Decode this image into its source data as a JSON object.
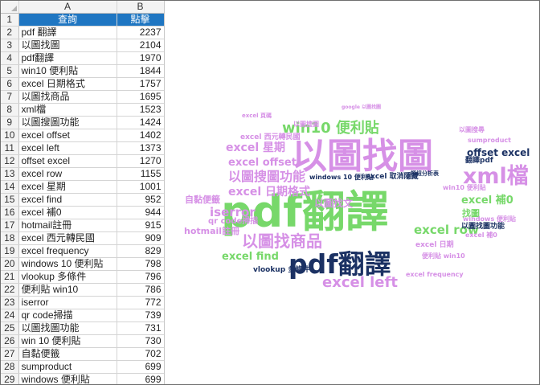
{
  "sheet": {
    "columns": [
      "A",
      "B"
    ],
    "headers": {
      "term": "查詢",
      "clicks": "點擊"
    },
    "header_fill": "#1f76c2",
    "rows": [
      [
        "pdf 翻譯",
        "2237"
      ],
      [
        "以圖找圖",
        "2104"
      ],
      [
        "pdf翻譯",
        "1970"
      ],
      [
        "win10 便利貼",
        "1844"
      ],
      [
        "excel 日期格式",
        "1757"
      ],
      [
        "以圖找商品",
        "1695"
      ],
      [
        "xml檔",
        "1523"
      ],
      [
        "以圖搜圖功能",
        "1424"
      ],
      [
        "excel offset",
        "1402"
      ],
      [
        "excel left",
        "1373"
      ],
      [
        "offset excel",
        "1270"
      ],
      [
        "excel row",
        "1155"
      ],
      [
        "excel 星期",
        "1001"
      ],
      [
        "excel find",
        "952"
      ],
      [
        "excel 補0",
        "944"
      ],
      [
        "hotmail註冊",
        "915"
      ],
      [
        "excel 西元轉民國",
        "909"
      ],
      [
        "excel frequency",
        "829"
      ],
      [
        "windows 10 便利貼",
        "798"
      ],
      [
        "vlookup 多條件",
        "796"
      ],
      [
        "便利貼 win10",
        "786"
      ],
      [
        "iserror",
        "772"
      ],
      [
        "qr code掃描",
        "739"
      ],
      [
        "以圖找圖功能",
        "731"
      ],
      [
        "win 10 便利貼",
        "730"
      ],
      [
        "自黏便籤",
        "702"
      ],
      [
        "sumproduct",
        "699"
      ],
      [
        "windows 便利貼",
        "699"
      ]
    ]
  },
  "cloud": {
    "colors": {
      "green": "#77d86a",
      "violet": "#d690e6",
      "navy": "#1b3163"
    },
    "words": [
      {
        "text": "pdf翻譯",
        "color": "green"
      },
      {
        "text": "以圖找圖",
        "color": "violet"
      },
      {
        "text": "pdf翻譯",
        "color": "navy"
      },
      {
        "text": "xml檔",
        "color": "violet"
      },
      {
        "text": "win10 便利貼",
        "color": "green"
      },
      {
        "text": "以圖找商品",
        "color": "violet"
      },
      {
        "text": "以圖搜圖功能",
        "color": "violet"
      },
      {
        "text": "excel left",
        "color": "violet"
      },
      {
        "text": "excel 日期格式",
        "color": "violet"
      },
      {
        "text": "excel row",
        "color": "green"
      },
      {
        "text": "excel 星期",
        "color": "violet"
      },
      {
        "text": "iserror",
        "color": "violet"
      },
      {
        "text": "excel 補0",
        "color": "green"
      },
      {
        "text": "excel offset",
        "color": "violet"
      },
      {
        "text": "excel find",
        "color": "green"
      },
      {
        "text": "offset excel",
        "color": "navy"
      },
      {
        "text": "hotmail註冊",
        "color": "violet"
      },
      {
        "text": "自黏便籤",
        "color": "violet"
      },
      {
        "text": "以圖找文",
        "color": "violet"
      },
      {
        "text": "找圖",
        "color": "green"
      },
      {
        "text": "qr code掃描",
        "color": "violet"
      },
      {
        "text": "vlookup 多條件",
        "color": "navy"
      },
      {
        "text": "sumproduct",
        "color": "violet"
      },
      {
        "text": "excel 西元轉民國",
        "color": "violet"
      },
      {
        "text": "以圖找圖功能",
        "color": "navy"
      },
      {
        "text": "excel 日期",
        "color": "violet"
      },
      {
        "text": "便利貼 win10",
        "color": "violet"
      },
      {
        "text": "excel frequency",
        "color": "violet"
      },
      {
        "text": "windows 10 便利貼",
        "color": "navy"
      },
      {
        "text": "excel 取消隱藏",
        "color": "navy"
      },
      {
        "text": "樞紐分析表",
        "color": "navy"
      },
      {
        "text": "windows 便利貼",
        "color": "violet"
      },
      {
        "text": "翻譯pdf",
        "color": "navy"
      },
      {
        "text": "以圖搜尋",
        "color": "violet"
      },
      {
        "text": "以圖搜圖",
        "color": "violet"
      },
      {
        "text": "win10 便利貼",
        "color": "violet"
      },
      {
        "text": "excel 補0",
        "color": "violet"
      },
      {
        "text": "excel 頁碼",
        "color": "violet"
      },
      {
        "text": "google 以圖找圖",
        "color": "violet"
      },
      {
        "text": "excel 轉換",
        "color": "violet"
      }
    ]
  }
}
